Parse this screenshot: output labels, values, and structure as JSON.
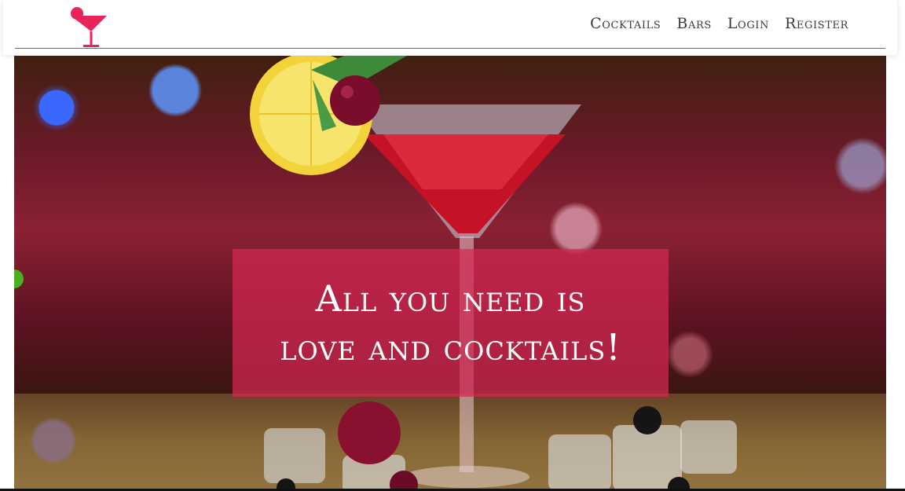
{
  "header": {
    "logo_icon": "cocktail-glass-icon",
    "accent_color": "#d9336e",
    "nav": [
      {
        "label": "Cocktails"
      },
      {
        "label": "Bars"
      },
      {
        "label": "Login"
      },
      {
        "label": "Register"
      }
    ]
  },
  "hero": {
    "image": "red-martini-cocktail-photo",
    "tagline": "All you need is love and cocktails!",
    "overlay_color": "#d62852"
  }
}
